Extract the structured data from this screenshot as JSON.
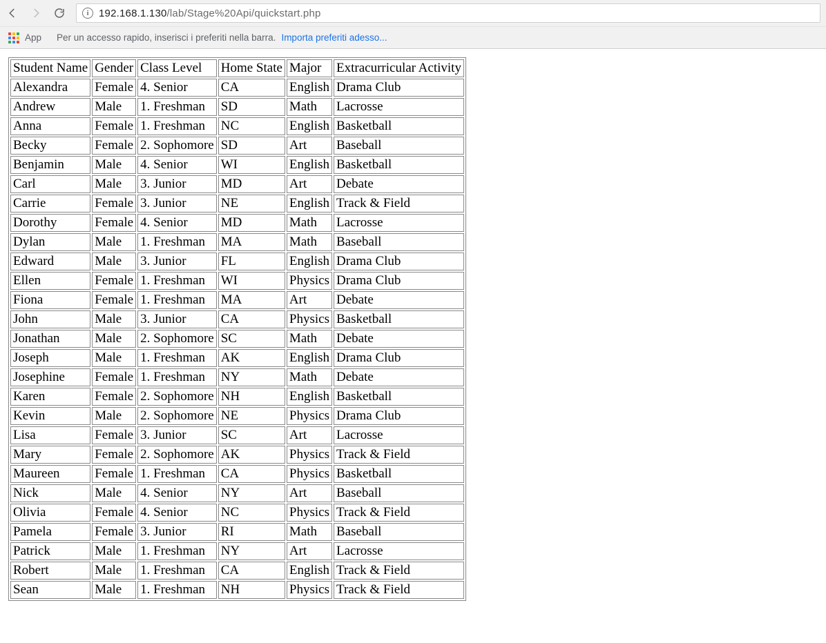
{
  "browser": {
    "url_host": "192.168.1.130",
    "url_path": "/lab/Stage%20Api/quickstart.php",
    "bookmarks_app_label": "App",
    "bookmarks_hint": "Per un accesso rapido, inserisci i preferiti nella barra.",
    "bookmarks_import": "Importa preferiti adesso...",
    "apps_colors": [
      "#ea4335",
      "#fbbc05",
      "#34a853",
      "#4285f4",
      "#ea4335",
      "#fbbc05",
      "#34a853",
      "#4285f4",
      "#ea4335"
    ]
  },
  "table": {
    "headers": [
      "Student Name",
      "Gender",
      "Class Level",
      "Home State",
      "Major",
      "Extracurricular Activity"
    ],
    "rows": [
      [
        "Alexandra",
        "Female",
        "4. Senior",
        "CA",
        "English",
        "Drama Club"
      ],
      [
        "Andrew",
        "Male",
        "1. Freshman",
        "SD",
        "Math",
        "Lacrosse"
      ],
      [
        "Anna",
        "Female",
        "1. Freshman",
        "NC",
        "English",
        "Basketball"
      ],
      [
        "Becky",
        "Female",
        "2. Sophomore",
        "SD",
        "Art",
        "Baseball"
      ],
      [
        "Benjamin",
        "Male",
        "4. Senior",
        "WI",
        "English",
        "Basketball"
      ],
      [
        "Carl",
        "Male",
        "3. Junior",
        "MD",
        "Art",
        "Debate"
      ],
      [
        "Carrie",
        "Female",
        "3. Junior",
        "NE",
        "English",
        "Track & Field"
      ],
      [
        "Dorothy",
        "Female",
        "4. Senior",
        "MD",
        "Math",
        "Lacrosse"
      ],
      [
        "Dylan",
        "Male",
        "1. Freshman",
        "MA",
        "Math",
        "Baseball"
      ],
      [
        "Edward",
        "Male",
        "3. Junior",
        "FL",
        "English",
        "Drama Club"
      ],
      [
        "Ellen",
        "Female",
        "1. Freshman",
        "WI",
        "Physics",
        "Drama Club"
      ],
      [
        "Fiona",
        "Female",
        "1. Freshman",
        "MA",
        "Art",
        "Debate"
      ],
      [
        "John",
        "Male",
        "3. Junior",
        "CA",
        "Physics",
        "Basketball"
      ],
      [
        "Jonathan",
        "Male",
        "2. Sophomore",
        "SC",
        "Math",
        "Debate"
      ],
      [
        "Joseph",
        "Male",
        "1. Freshman",
        "AK",
        "English",
        "Drama Club"
      ],
      [
        "Josephine",
        "Female",
        "1. Freshman",
        "NY",
        "Math",
        "Debate"
      ],
      [
        "Karen",
        "Female",
        "2. Sophomore",
        "NH",
        "English",
        "Basketball"
      ],
      [
        "Kevin",
        "Male",
        "2. Sophomore",
        "NE",
        "Physics",
        "Drama Club"
      ],
      [
        "Lisa",
        "Female",
        "3. Junior",
        "SC",
        "Art",
        "Lacrosse"
      ],
      [
        "Mary",
        "Female",
        "2. Sophomore",
        "AK",
        "Physics",
        "Track & Field"
      ],
      [
        "Maureen",
        "Female",
        "1. Freshman",
        "CA",
        "Physics",
        "Basketball"
      ],
      [
        "Nick",
        "Male",
        "4. Senior",
        "NY",
        "Art",
        "Baseball"
      ],
      [
        "Olivia",
        "Female",
        "4. Senior",
        "NC",
        "Physics",
        "Track & Field"
      ],
      [
        "Pamela",
        "Female",
        "3. Junior",
        "RI",
        "Math",
        "Baseball"
      ],
      [
        "Patrick",
        "Male",
        "1. Freshman",
        "NY",
        "Art",
        "Lacrosse"
      ],
      [
        "Robert",
        "Male",
        "1. Freshman",
        "CA",
        "English",
        "Track & Field"
      ],
      [
        "Sean",
        "Male",
        "1. Freshman",
        "NH",
        "Physics",
        "Track & Field"
      ]
    ]
  }
}
